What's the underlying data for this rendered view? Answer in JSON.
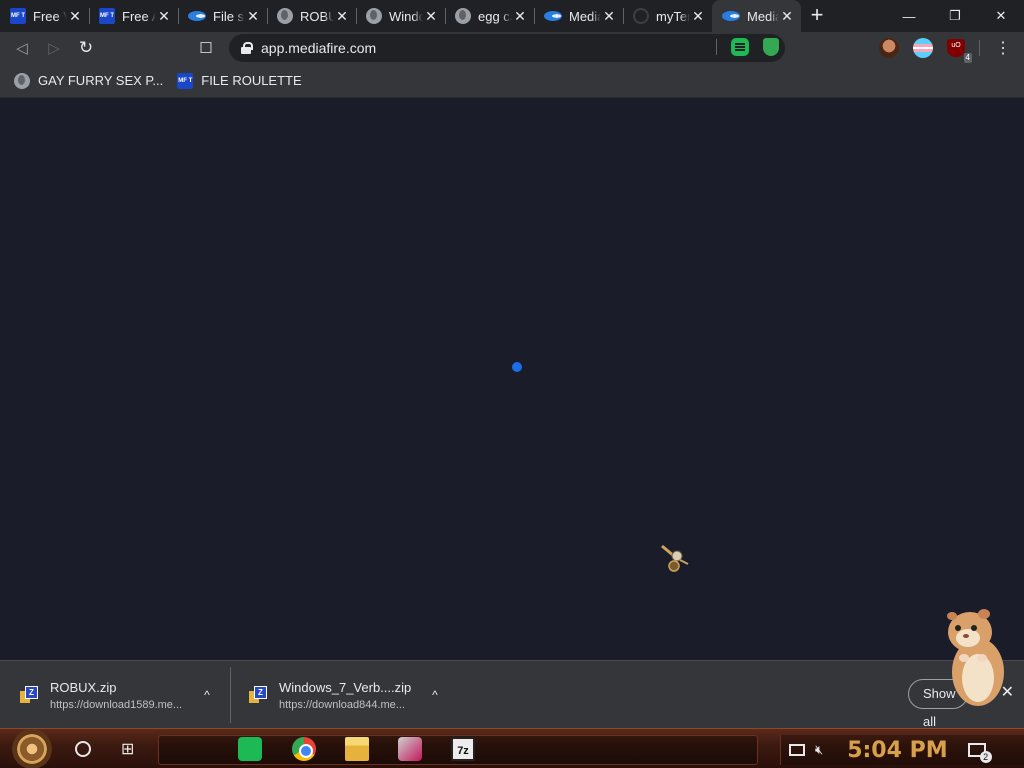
{
  "browser": {
    "tabs": [
      {
        "title": "Free V",
        "icon": "mft-icon"
      },
      {
        "title": "Free A",
        "icon": "mft-icon"
      },
      {
        "title": "File sh",
        "icon": "mediafire-icon"
      },
      {
        "title": "ROBUX",
        "icon": "globe-icon"
      },
      {
        "title": "Windo",
        "icon": "globe-icon"
      },
      {
        "title": "egg ca",
        "icon": "globe-icon"
      },
      {
        "title": "Media",
        "icon": "mediafire-icon"
      },
      {
        "title": "myTer",
        "icon": "loading-icon"
      },
      {
        "title": "Media",
        "icon": "mediafire-icon",
        "active": true
      }
    ],
    "new_tab_label": "+",
    "window_controls": {
      "minimize": "—",
      "restore": "❐",
      "close": "✕"
    },
    "toolbar": {
      "back": "◁",
      "forward": "▷",
      "reload": "↻",
      "bookmark": "☐",
      "url": "app.mediafire.com",
      "menu": "⋮",
      "ublock_label": "uO",
      "ublock_badge": "4"
    },
    "bookmarks": [
      {
        "label": "GAY FURRY SEX P...",
        "icon": "globe-icon"
      },
      {
        "label": "FILE ROULETTE",
        "icon": "mft-icon"
      }
    ],
    "mft_icon_text": "MF T"
  },
  "downloads": [
    {
      "name": "ROBUX.zip",
      "url": "https://download1589.me..."
    },
    {
      "name": "Windows_7_Verb....zip",
      "url": "https://download844.me..."
    }
  ],
  "shelf": {
    "show_all": "Show all",
    "close": "✕",
    "chevron": "^"
  },
  "taskbar": {
    "seven_zip_label": "7z",
    "clock": "5:04 PM",
    "notification_count": "2"
  },
  "colors": {
    "content_bg": "#1a1d29",
    "spinner": "#1b6ee8",
    "clock": "#d9a04c"
  }
}
